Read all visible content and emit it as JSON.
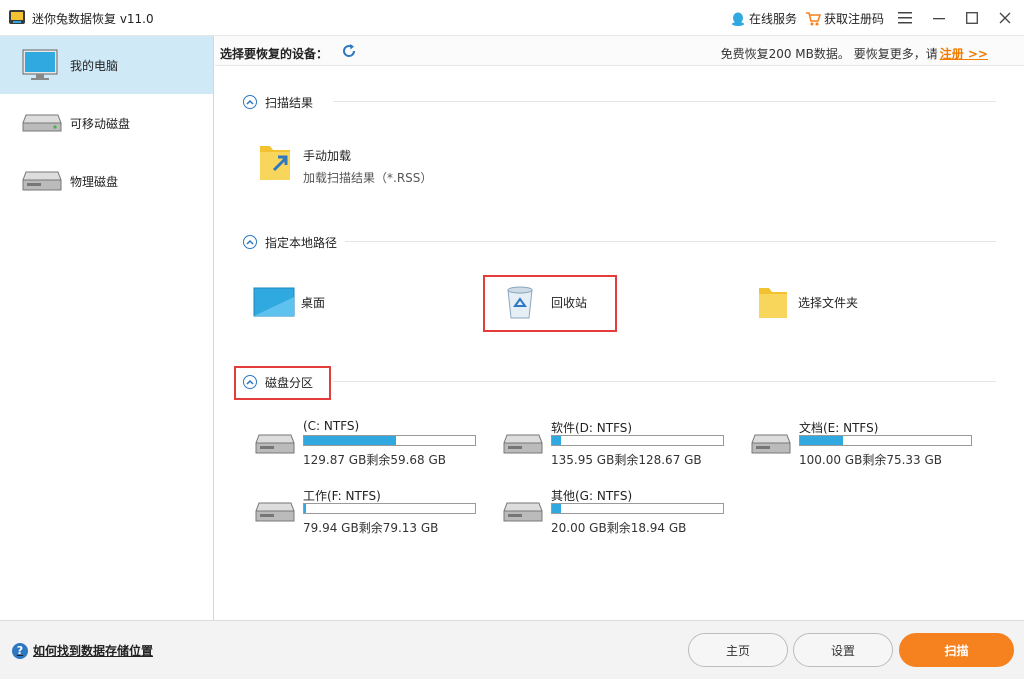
{
  "app": {
    "title": "迷你兔数据恢复 v11.0"
  },
  "titlebar": {
    "online_service": "在线服务",
    "get_code": "获取注册码"
  },
  "sidebar": {
    "items": [
      {
        "label": "我的电脑"
      },
      {
        "label": "可移动磁盘"
      },
      {
        "label": "物理磁盘"
      }
    ]
  },
  "toolbar": {
    "title": "选择要恢复的设备：",
    "free_note": "免费恢复200 MB数据。 要恢复更多，请",
    "register_link": "注册 >>"
  },
  "sections": {
    "scan_results": {
      "title": "扫描结果",
      "manual_load": {
        "label": "手动加载",
        "sub": "加载扫描结果（*.RSS）"
      }
    },
    "local_path": {
      "title": "指定本地路径",
      "items": [
        {
          "label": "桌面"
        },
        {
          "label": "回收站"
        },
        {
          "label": "选择文件夹"
        }
      ]
    },
    "partitions": {
      "title": "磁盘分区",
      "disks": [
        {
          "name": "(C: NTFS)",
          "size": "129.87 GB剩余59.68 GB",
          "used_fraction": 0.54
        },
        {
          "name": "软件(D: NTFS)",
          "size": "135.95 GB剩余128.67 GB",
          "used_fraction": 0.05
        },
        {
          "name": "文档(E: NTFS)",
          "size": "100.00 GB剩余75.33 GB",
          "used_fraction": 0.25
        },
        {
          "name": "工作(F: NTFS)",
          "size": "79.94 GB剩余79.13 GB",
          "used_fraction": 0.01
        },
        {
          "name": "其他(G: NTFS)",
          "size": "20.00 GB剩余18.94 GB",
          "used_fraction": 0.05
        }
      ]
    }
  },
  "bottom": {
    "help_link": "如何找到数据存储位置",
    "home_button": "主页",
    "settings_button": "设置",
    "scan_button": "扫描"
  },
  "colors": {
    "accent_blue": "#2fa9e0",
    "scan_orange": "#f5821f",
    "highlight_red": "#e23c3c",
    "sidebar_active": "#cfe9f7"
  }
}
